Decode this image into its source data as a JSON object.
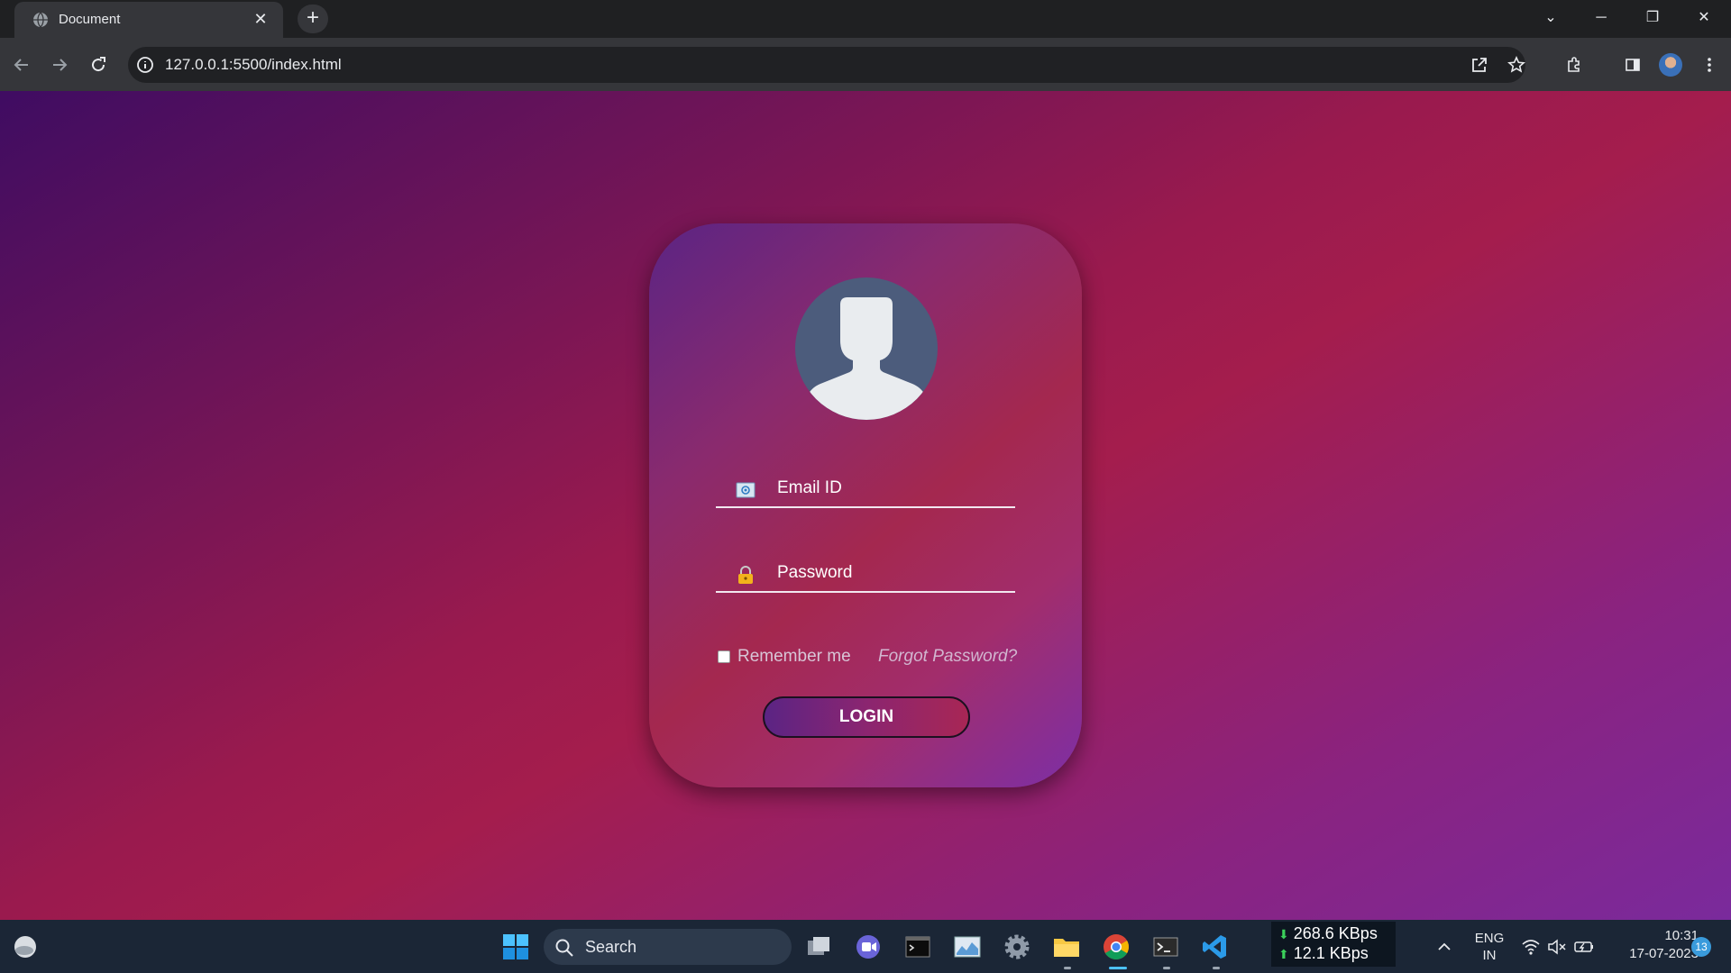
{
  "browser": {
    "tab_title": "Document",
    "url": "127.0.0.1:5500/index.html"
  },
  "login_form": {
    "email_label": "Email ID",
    "password_label": "Password",
    "remember_label": "Remember me",
    "remember_checked": false,
    "forgot_label": "Forgot Password?",
    "login_button": "LOGIN",
    "icons": {
      "email": "email-icon",
      "password": "lock-icon",
      "avatar": "user-silhouette-icon"
    }
  },
  "taskbar": {
    "search_label": "Search",
    "net_down": "268.6 KBps",
    "net_up": "12.1 KBps",
    "lang_top": "ENG",
    "lang_bottom": "IN",
    "time": "10:31",
    "date": "17-07-2023",
    "notification_count": "13"
  },
  "colors": {
    "page_gradient_start": "#3f0c62",
    "page_gradient_mid": "#a41d4d",
    "page_gradient_end": "#7a2a9c",
    "button_gradient_start": "#5b2484",
    "button_gradient_end": "#a82655"
  }
}
